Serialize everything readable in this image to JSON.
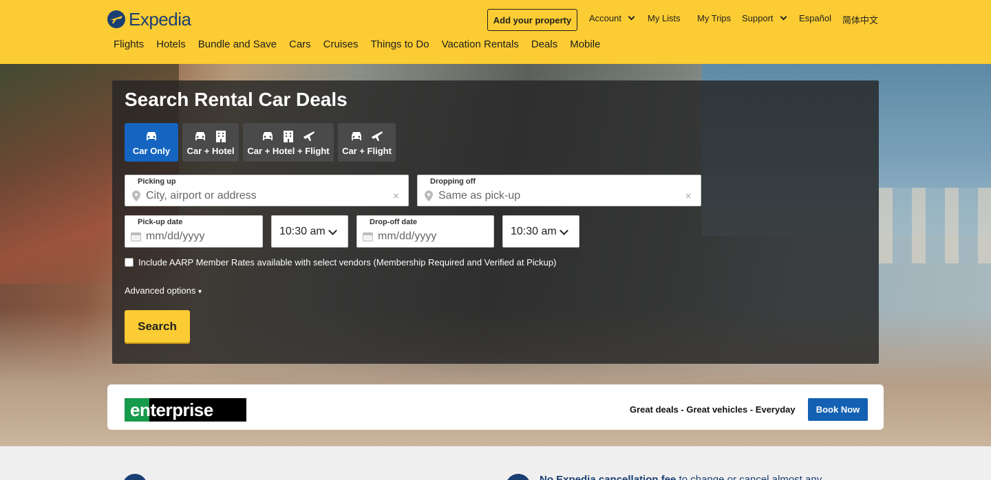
{
  "header": {
    "logo_text": "Expedia",
    "add_property": "Add your property",
    "account": "Account",
    "my_lists": "My Lists",
    "my_trips": "My Trips",
    "support": "Support",
    "lang_es": "Español",
    "lang_zh": "简体中文",
    "nav": [
      "Flights",
      "Hotels",
      "Bundle and Save",
      "Cars",
      "Cruises",
      "Things to Do",
      "Vacation Rentals",
      "Deals",
      "Mobile"
    ]
  },
  "search": {
    "title": "Search Rental Car Deals",
    "tabs": [
      {
        "label": "Car Only",
        "active": true
      },
      {
        "label": "Car + Hotel",
        "active": false
      },
      {
        "label": "Car + Hotel + Flight",
        "active": false
      },
      {
        "label": "Car + Flight",
        "active": false
      }
    ],
    "pickup": {
      "label": "Picking up",
      "placeholder": "City, airport or address"
    },
    "dropoff": {
      "label": "Dropping off",
      "placeholder": "Same as pick-up"
    },
    "pickup_date": {
      "label": "Pick-up date",
      "placeholder": "mm/dd/yyyy"
    },
    "pickup_time": "10:30 am",
    "dropoff_date": {
      "label": "Drop-off date",
      "placeholder": "mm/dd/yyyy"
    },
    "dropoff_time": "10:30 am",
    "aarp_label": "Include AARP Member Rates available with select vendors (Membership Required and Verified at Pickup)",
    "advanced": "Advanced options",
    "search_button": "Search"
  },
  "promo": {
    "brand": "enterprise",
    "tagline": "Great deals - Great vehicles - Everyday",
    "button": "Book Now"
  },
  "below": {
    "bold": "No Expedia cancellation fee",
    "rest": " to change or cancel almost any"
  },
  "colors": {
    "header_bg": "#fbcc33",
    "brand_blue": "#1a3f73",
    "active_tab": "#1565c0",
    "book_button": "#1461b3"
  }
}
